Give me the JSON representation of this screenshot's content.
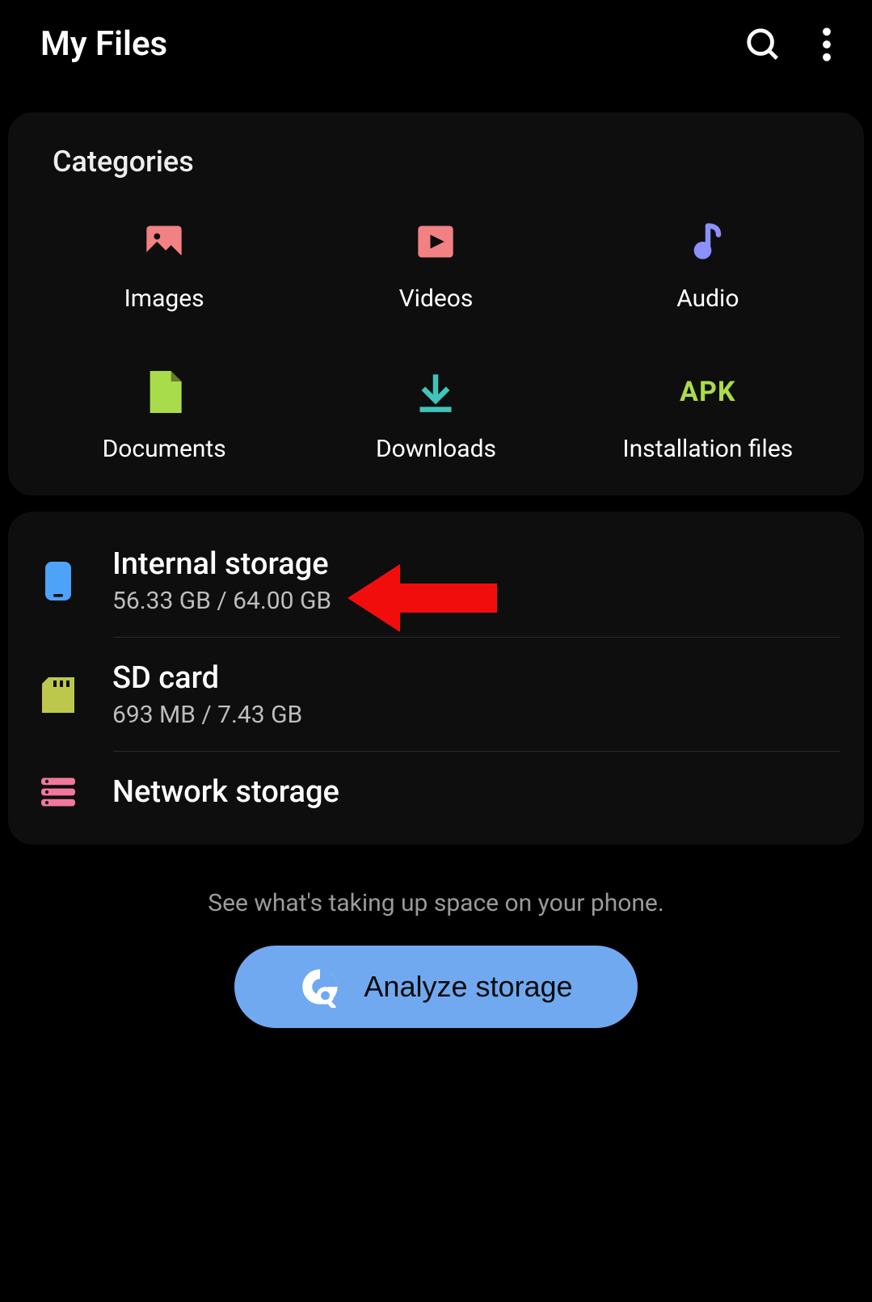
{
  "header": {
    "title": "My Files"
  },
  "categories": {
    "title": "Categories",
    "items": [
      {
        "label": "Images",
        "icon": "images-icon"
      },
      {
        "label": "Videos",
        "icon": "videos-icon"
      },
      {
        "label": "Audio",
        "icon": "audio-icon"
      },
      {
        "label": "Documents",
        "icon": "documents-icon"
      },
      {
        "label": "Downloads",
        "icon": "downloads-icon"
      },
      {
        "label": "Installation files",
        "icon": "apk-icon"
      }
    ]
  },
  "storage": {
    "items": [
      {
        "title": "Internal storage",
        "subtitle": "56.33 GB / 64.00 GB",
        "icon": "phone-icon"
      },
      {
        "title": "SD card",
        "subtitle": "693 MB / 7.43 GB",
        "icon": "sdcard-icon"
      },
      {
        "title": "Network storage",
        "subtitle": "",
        "icon": "network-icon"
      }
    ]
  },
  "footer": {
    "hint": "See what's taking up space on your phone.",
    "button": "Analyze storage"
  },
  "annotation": {
    "arrow_color": "#f20d0d"
  }
}
